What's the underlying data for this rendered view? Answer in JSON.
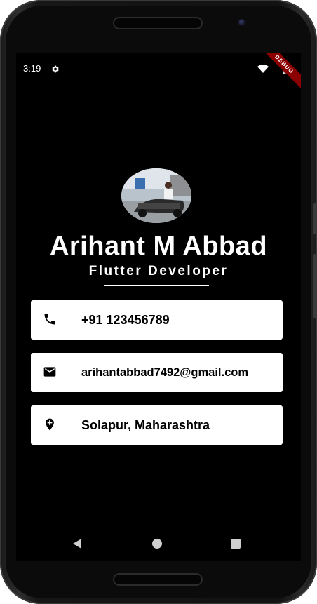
{
  "status_bar": {
    "time": "3:19"
  },
  "debug_banner": {
    "label": "DEBUG"
  },
  "profile": {
    "name": "Arihant M Abbad",
    "title": "Flutter Developer"
  },
  "contacts": {
    "phone": "+91 123456789",
    "email": "arihantabbad7492@gmail.com",
    "location": "Solapur, Maharashtra"
  },
  "icons": {
    "phone": "phone-icon",
    "email": "mail-icon",
    "location": "location-pin-icon",
    "settings": "gear-icon"
  },
  "colors": {
    "background": "#000000",
    "card": "#ffffff",
    "text_primary": "#ffffff",
    "debug_banner": "#8b0000"
  }
}
